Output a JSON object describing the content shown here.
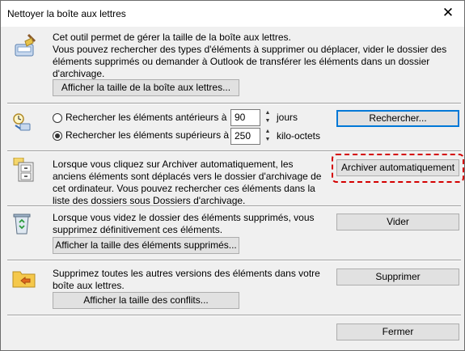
{
  "window": {
    "title": "Nettoyer la boîte aux lettres",
    "close_glyph": "✕"
  },
  "section1": {
    "icon": "mailbox-broom-icon",
    "description": "Cet outil permet de gérer la taille de la boîte aux lettres.\nVous pouvez rechercher des types d'éléments à supprimer ou déplacer, vider le dossier des éléments supprimés ou demander à Outlook de transférer les éléments dans un dossier d'archivage.",
    "button": "Afficher la taille de la boîte aux lettres..."
  },
  "section2": {
    "icon": "search-clock-icon",
    "older_label": "Rechercher les éléments antérieurs à",
    "older_value": "90",
    "older_unit": "jours",
    "larger_label": "Rechercher les éléments supérieurs à",
    "larger_value": "250",
    "larger_unit": "kilo-octets",
    "search_button": "Rechercher..."
  },
  "section3": {
    "icon": "archive-cabinet-icon",
    "description": "Lorsque vous cliquez sur Archiver automatiquement, les anciens éléments sont déplacés vers le dossier d'archivage de cet ordinateur. Vous pouvez rechercher ces éléments dans la liste des dossiers sous Dossiers d'archivage.",
    "button": "Archiver automatiquement"
  },
  "section4": {
    "icon": "recycle-bin-icon",
    "description": "Lorsque vous videz le dossier des éléments supprimés, vous supprimez définitivement ces éléments.",
    "size_button": "Afficher la taille des éléments supprimés...",
    "empty_button": "Vider"
  },
  "section5": {
    "icon": "conflict-folder-icon",
    "description": "Supprimez toutes les autres versions des éléments dans votre boîte aux lettres.",
    "size_button": "Afficher la taille des conflits...",
    "delete_button": "Supprimer"
  },
  "footer": {
    "close_button": "Fermer"
  },
  "colors": {
    "highlight_box": "#d40000",
    "dialog_bg": "#f0f0f0",
    "button_bg": "#e1e1e1",
    "focus_border": "#0078d7"
  }
}
